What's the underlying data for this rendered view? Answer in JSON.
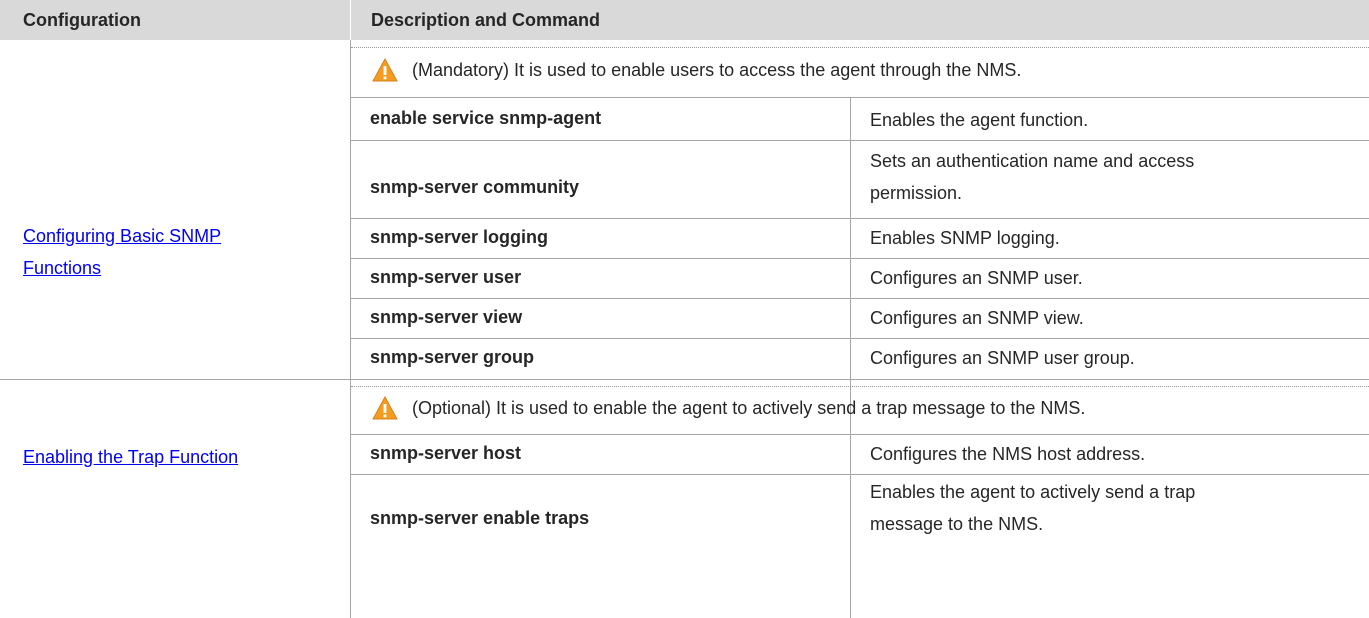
{
  "header": {
    "configuration": "Configuration",
    "description": "Description and Command"
  },
  "sections": [
    {
      "link": "Configuring Basic SNMP Functions",
      "link_lines": [
        "Configuring Basic SNMP ",
        "Functions"
      ],
      "note": "(Mandatory) It is used to enable users to access the agent through the NMS.",
      "note_icon": "warning-icon",
      "rows": [
        {
          "command": "enable service snmp-agent",
          "description": "Enables the agent function."
        },
        {
          "command": "snmp-server community",
          "description": "Sets an authentication name and access permission.",
          "description_lines": [
            "Sets an authentication name and access",
            "permission."
          ]
        },
        {
          "command": "snmp-server logging",
          "description": "Enables SNMP logging."
        },
        {
          "command": "snmp-server user",
          "description": "Configures an SNMP user."
        },
        {
          "command": "snmp-server view",
          "description": "Configures an SNMP view."
        },
        {
          "command": "snmp-server group",
          "description": "Configures an SNMP user group."
        }
      ]
    },
    {
      "link": "Enabling the Trap Function",
      "note": "(Optional) It is used to enable the agent to actively send a trap message to the NMS.",
      "note_icon": "warning-icon",
      "rows": [
        {
          "command": "snmp-server host",
          "description": "Configures the NMS host address."
        },
        {
          "command": "snmp-server enable traps",
          "description": "Enables the agent to actively send a trap message to the NMS.",
          "description_lines": [
            "Enables the agent to actively send a trap",
            "message to the NMS."
          ]
        }
      ]
    }
  ],
  "colors": {
    "header_bg": "#d9d9d9",
    "link": "#0000ee",
    "warning_fill": "#f39c1f",
    "grid": "#a6a6a6"
  }
}
